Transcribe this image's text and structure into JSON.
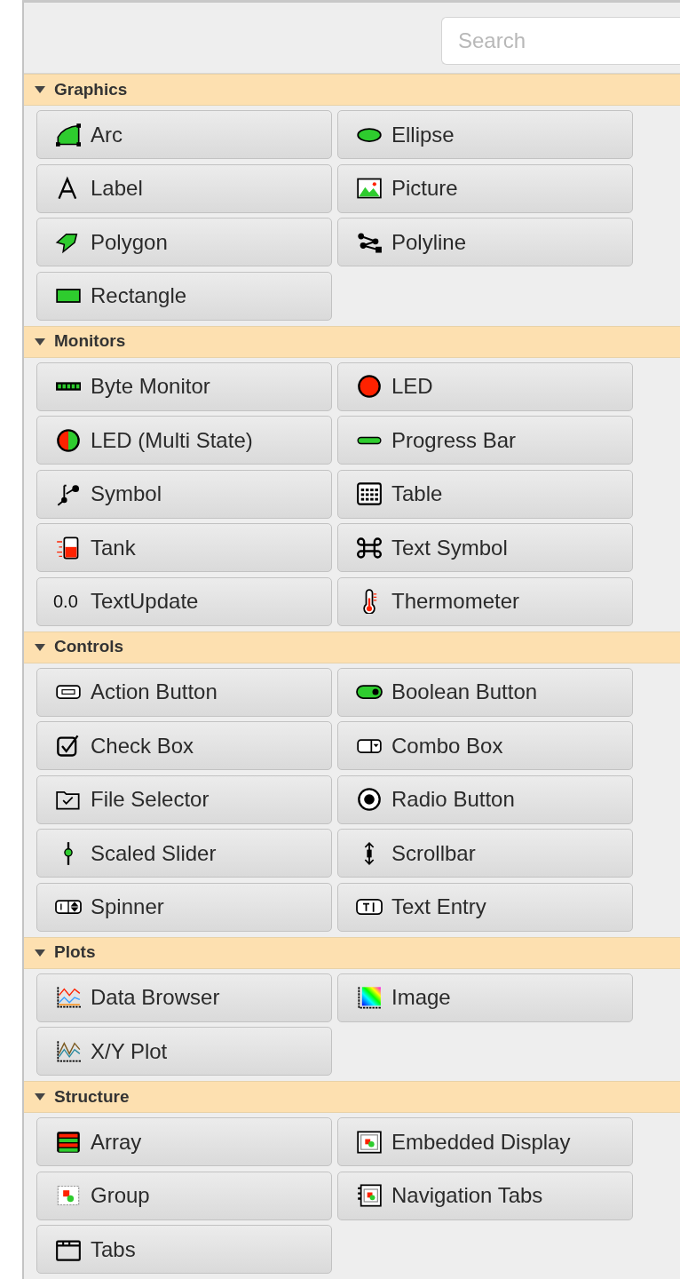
{
  "search": {
    "placeholder": "Search"
  },
  "sections": [
    {
      "title": "Graphics",
      "expanded": true,
      "items": [
        {
          "label": "Arc"
        },
        {
          "label": "Ellipse"
        },
        {
          "label": "Label"
        },
        {
          "label": "Picture"
        },
        {
          "label": "Polygon"
        },
        {
          "label": "Polyline"
        },
        {
          "label": "Rectangle"
        }
      ]
    },
    {
      "title": "Monitors",
      "expanded": true,
      "items": [
        {
          "label": "Byte Monitor"
        },
        {
          "label": "LED"
        },
        {
          "label": "LED (Multi State)"
        },
        {
          "label": "Progress Bar"
        },
        {
          "label": "Symbol"
        },
        {
          "label": "Table"
        },
        {
          "label": "Tank"
        },
        {
          "label": "Text Symbol"
        },
        {
          "label": "TextUpdate",
          "icon_text": "0.0"
        },
        {
          "label": "Thermometer"
        }
      ]
    },
    {
      "title": "Controls",
      "expanded": true,
      "items": [
        {
          "label": "Action Button"
        },
        {
          "label": "Boolean Button"
        },
        {
          "label": "Check Box"
        },
        {
          "label": "Combo Box"
        },
        {
          "label": "File Selector"
        },
        {
          "label": "Radio Button"
        },
        {
          "label": "Scaled Slider"
        },
        {
          "label": "Scrollbar"
        },
        {
          "label": "Spinner"
        },
        {
          "label": "Text Entry"
        }
      ]
    },
    {
      "title": "Plots",
      "expanded": true,
      "items": [
        {
          "label": "Data Browser"
        },
        {
          "label": "Image"
        },
        {
          "label": "X/Y Plot"
        }
      ]
    },
    {
      "title": "Structure",
      "expanded": true,
      "items": [
        {
          "label": "Array"
        },
        {
          "label": "Embedded Display"
        },
        {
          "label": "Group"
        },
        {
          "label": "Navigation Tabs"
        },
        {
          "label": "Tabs"
        }
      ]
    }
  ]
}
